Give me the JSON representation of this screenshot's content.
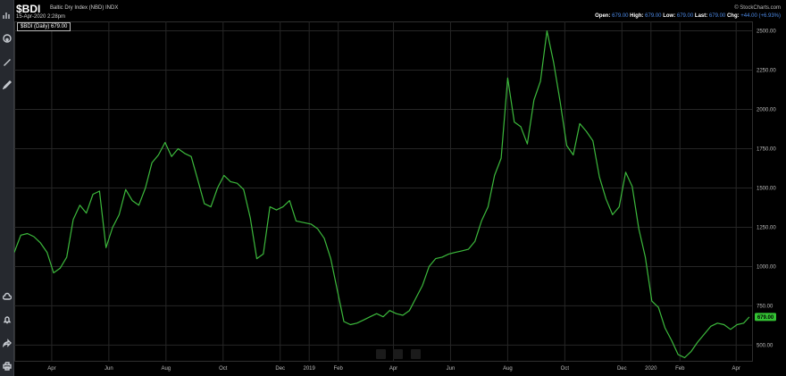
{
  "header": {
    "symbol": "$BDI",
    "name": "Baltic Dry Index (NBD)  INDX",
    "timestamp": "15-Apr-2020 2:28pm",
    "copyright": "© StockCharts.com",
    "ohlc": {
      "open_label": "Open:",
      "open": "679.00",
      "high_label": "High:",
      "high": "679.00",
      "low_label": "Low:",
      "low": "679.00",
      "last_label": "Last:",
      "last": "679.00",
      "chg_label": "Chg:",
      "chg": "+44.00 (+6.93%)"
    }
  },
  "toolbar": {
    "icons": [
      "chart-icon",
      "palette-icon",
      "brush-icon",
      "pencil-icon",
      "cloud-icon",
      "bell-icon",
      "share-icon",
      "print-icon"
    ]
  },
  "colors": {
    "line": "#3cb93c",
    "background": "#000000",
    "grid": "#262626",
    "tag": "#33c233"
  },
  "chart_data": {
    "type": "line",
    "title": "$BDI (Daily) 679.00",
    "x_labels": [
      {
        "label": "Apr",
        "x": "2018-04-01"
      },
      {
        "label": "Jun",
        "x": "2018-06-01"
      },
      {
        "label": "Aug",
        "x": "2018-08-01"
      },
      {
        "label": "Oct",
        "x": "2018-10-01"
      },
      {
        "label": "Dec",
        "x": "2018-12-01"
      },
      {
        "label": "2019",
        "x": "2019-01-01"
      },
      {
        "label": "Feb",
        "x": "2019-02-01"
      },
      {
        "label": "Apr",
        "x": "2019-04-01"
      },
      {
        "label": "Jun",
        "x": "2019-06-01"
      },
      {
        "label": "Aug",
        "x": "2019-08-01"
      },
      {
        "label": "Oct",
        "x": "2019-10-01"
      },
      {
        "label": "Dec",
        "x": "2019-12-01"
      },
      {
        "label": "2020",
        "x": "2020-01-01"
      },
      {
        "label": "Feb",
        "x": "2020-02-01"
      },
      {
        "label": "Apr",
        "x": "2020-04-01"
      }
    ],
    "y_ticks": [
      "500.00",
      "750.00",
      "1000.00",
      "1250.00",
      "1500.00",
      "1750.00",
      "2000.00",
      "2250.00",
      "2500.00"
    ],
    "ylim": [
      400,
      2560
    ],
    "last_value": "679.00",
    "series": [
      {
        "x": [
          "2018-02-20",
          "2018-02-27",
          "2018-03-06",
          "2018-03-13",
          "2018-03-20",
          "2018-03-27",
          "2018-04-03",
          "2018-04-10",
          "2018-04-17",
          "2018-04-24",
          "2018-05-01",
          "2018-05-08",
          "2018-05-15",
          "2018-05-22",
          "2018-05-29",
          "2018-06-05",
          "2018-06-12",
          "2018-06-19",
          "2018-06-26",
          "2018-07-03",
          "2018-07-10",
          "2018-07-17",
          "2018-07-24",
          "2018-07-31",
          "2018-08-07",
          "2018-08-14",
          "2018-08-21",
          "2018-08-28",
          "2018-09-04",
          "2018-09-11",
          "2018-09-18",
          "2018-09-25",
          "2018-10-02",
          "2018-10-09",
          "2018-10-16",
          "2018-10-23",
          "2018-10-30",
          "2018-11-06",
          "2018-11-13",
          "2018-11-20",
          "2018-11-27",
          "2018-12-04",
          "2018-12-11",
          "2018-12-18",
          "2019-01-03",
          "2019-01-10",
          "2019-01-17",
          "2019-01-24",
          "2019-01-31",
          "2019-02-07",
          "2019-02-14",
          "2019-02-21",
          "2019-02-28",
          "2019-03-07",
          "2019-03-14",
          "2019-03-21",
          "2019-03-28",
          "2019-04-04",
          "2019-04-11",
          "2019-04-18",
          "2019-04-25",
          "2019-05-02",
          "2019-05-09",
          "2019-05-16",
          "2019-05-23",
          "2019-05-30",
          "2019-06-06",
          "2019-06-13",
          "2019-06-20",
          "2019-06-27",
          "2019-07-04",
          "2019-07-11",
          "2019-07-18",
          "2019-07-25",
          "2019-08-01",
          "2019-08-08",
          "2019-08-15",
          "2019-08-22",
          "2019-08-29",
          "2019-09-05",
          "2019-09-12",
          "2019-09-19",
          "2019-09-26",
          "2019-10-03",
          "2019-10-10",
          "2019-10-17",
          "2019-10-24",
          "2019-10-31",
          "2019-11-07",
          "2019-11-14",
          "2019-11-21",
          "2019-11-28",
          "2019-12-05",
          "2019-12-12",
          "2019-12-19",
          "2019-12-26",
          "2020-01-02",
          "2020-01-09",
          "2020-01-16",
          "2020-01-23",
          "2020-01-30",
          "2020-02-06",
          "2020-02-13",
          "2020-02-20",
          "2020-02-27",
          "2020-03-05",
          "2020-03-12",
          "2020-03-19",
          "2020-03-26",
          "2020-04-02",
          "2020-04-09",
          "2020-04-15"
        ],
        "values": [
          1090,
          1200,
          1210,
          1190,
          1150,
          1090,
          960,
          990,
          1060,
          1300,
          1390,
          1340,
          1460,
          1480,
          1120,
          1250,
          1330,
          1490,
          1420,
          1390,
          1500,
          1660,
          1710,
          1790,
          1700,
          1750,
          1720,
          1700,
          1550,
          1400,
          1380,
          1500,
          1580,
          1540,
          1530,
          1490,
          1310,
          1050,
          1080,
          1380,
          1360,
          1380,
          1420,
          1290,
          1270,
          1240,
          1180,
          1050,
          850,
          650,
          630,
          640,
          660,
          680,
          700,
          680,
          720,
          700,
          690,
          720,
          800,
          880,
          1000,
          1050,
          1060,
          1080,
          1090,
          1100,
          1110,
          1160,
          1290,
          1380,
          1580,
          1690,
          2200,
          1920,
          1890,
          1780,
          2060,
          2180,
          2500,
          2300,
          2050,
          1770,
          1710,
          1910,
          1860,
          1800,
          1570,
          1430,
          1330,
          1380,
          1600,
          1510,
          1240,
          1060,
          780,
          740,
          610,
          530,
          440,
          420,
          460,
          520,
          570,
          620,
          640,
          630,
          600,
          630,
          640,
          679
        ]
      }
    ]
  }
}
